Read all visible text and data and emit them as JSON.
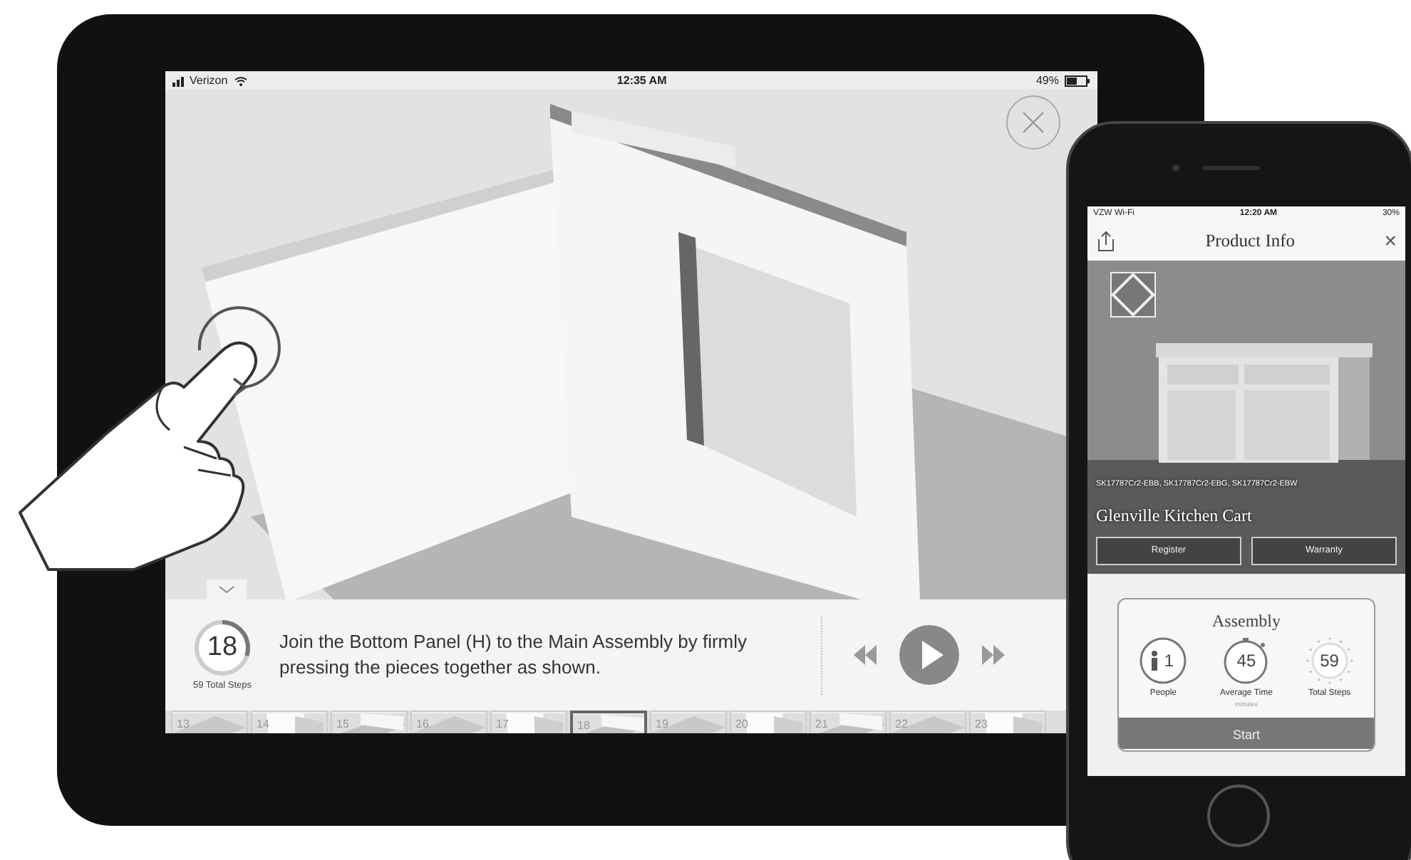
{
  "tablet": {
    "status_bar": {
      "carrier": "Verizon",
      "time": "12:35 AM",
      "battery": "49%"
    },
    "step": {
      "number": "18",
      "total": "59 Total Steps",
      "level": 0.3
    },
    "instruction": "Join the Bottom Panel (H) to the Main Assembly by firmly pressing the pieces together as shown.",
    "thumbnails": [
      {
        "label": "13",
        "selected": false
      },
      {
        "label": "14",
        "selected": false
      },
      {
        "label": "15",
        "selected": false
      },
      {
        "label": "16",
        "selected": false
      },
      {
        "label": "17",
        "selected": false
      },
      {
        "label": "18",
        "selected": true
      },
      {
        "label": "19",
        "selected": false
      },
      {
        "label": "20",
        "selected": false
      },
      {
        "label": "21",
        "selected": false
      },
      {
        "label": "22",
        "selected": false
      },
      {
        "label": "23",
        "selected": false
      }
    ]
  },
  "phone": {
    "status_bar": {
      "carrier": "VZW Wi-Fi",
      "time": "12:20 AM",
      "battery": "30%"
    },
    "title": "Product Info",
    "close": "×",
    "sku": "SK17787Cr2-EBB, SK17787Cr2-EBG, SK17787Cr2-EBW",
    "product": "Glenville Kitchen Cart",
    "buttons": [
      "Register",
      "Warranty"
    ],
    "assembly": {
      "title": "Assembly",
      "stats": [
        {
          "kind": "people",
          "value": "1",
          "label": "People"
        },
        {
          "kind": "time",
          "value": "45",
          "label": "Average Time",
          "sub": "minutes"
        },
        {
          "kind": "steps",
          "value": "59",
          "label": "Total Steps"
        }
      ],
      "start": "Start"
    }
  }
}
